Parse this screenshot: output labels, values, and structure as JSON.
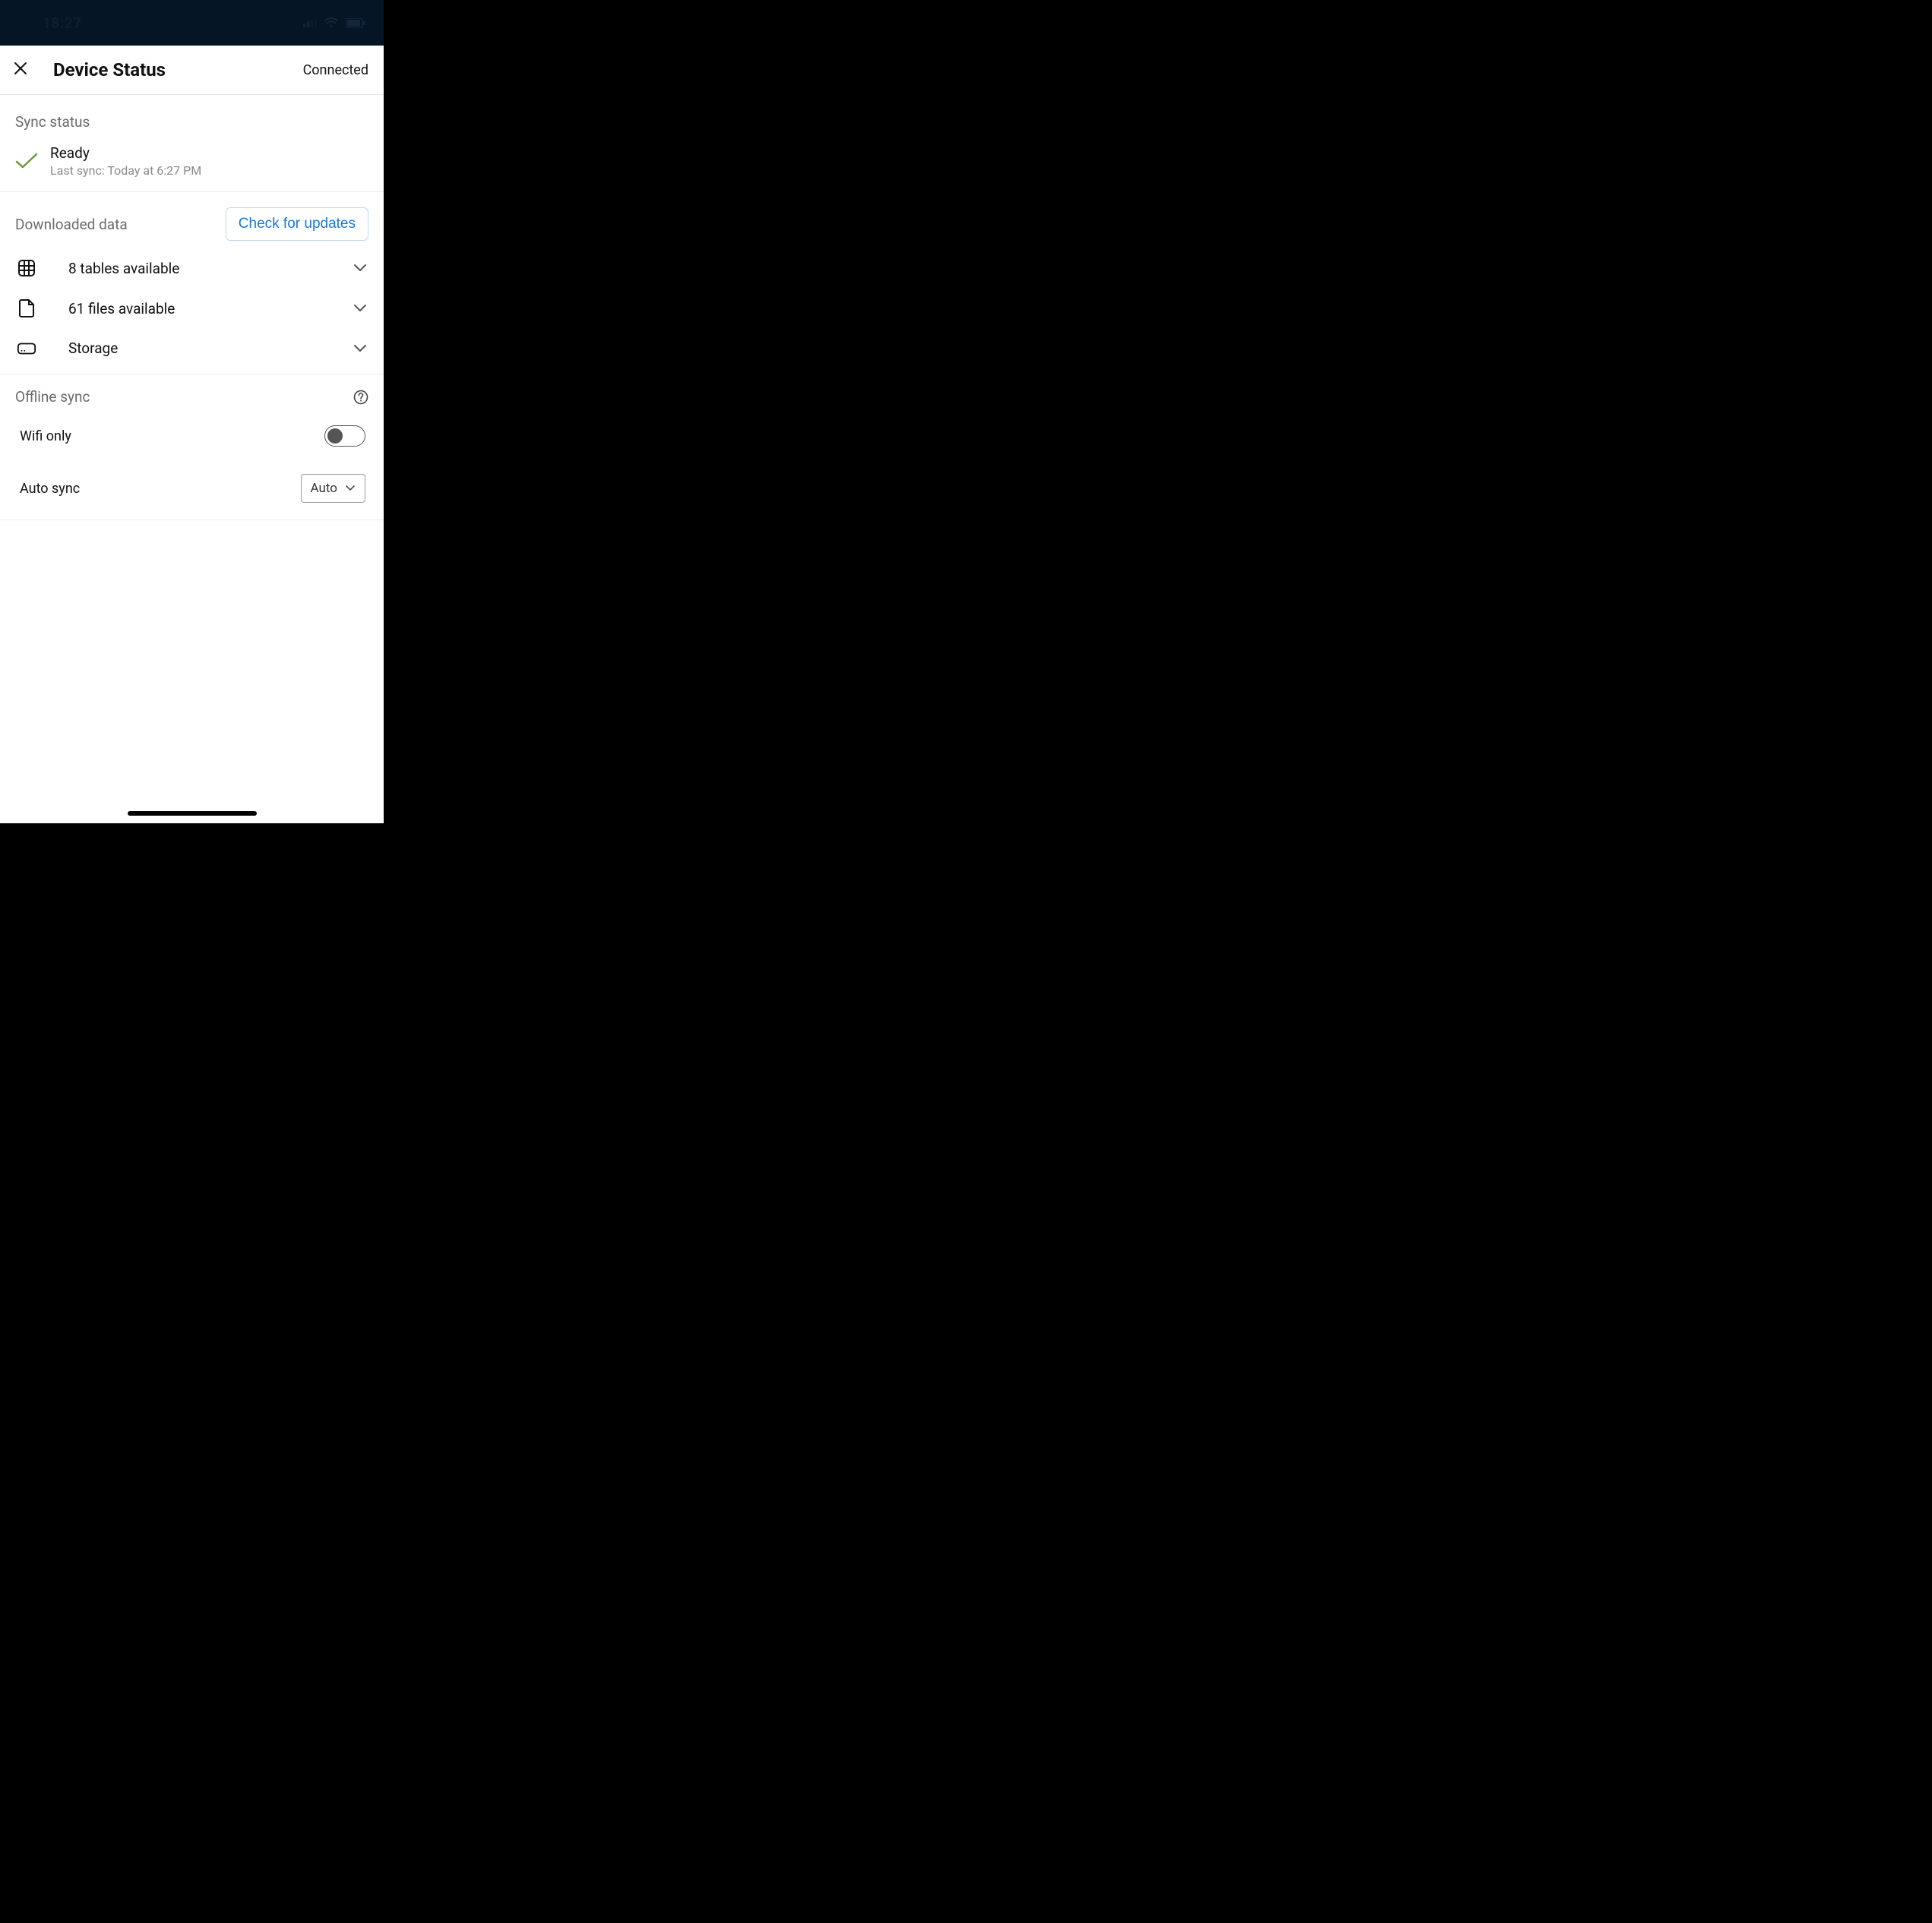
{
  "statusbar": {
    "time": "18:27"
  },
  "header": {
    "title": "Device Status",
    "connection": "Connected"
  },
  "sync": {
    "section_label": "Sync status",
    "ready_label": "Ready",
    "last_sync": "Last sync: Today at 6:27 PM"
  },
  "downloaded": {
    "section_label": "Downloaded data",
    "check_button": "Check for updates",
    "rows": [
      {
        "icon": "grid-icon",
        "label": "8 tables available"
      },
      {
        "icon": "file-icon",
        "label": "61 files available"
      },
      {
        "icon": "storage-icon",
        "label": "Storage"
      }
    ]
  },
  "offline": {
    "section_label": "Offline sync",
    "wifi_only_label": "Wifi only",
    "wifi_only_on": false,
    "auto_sync_label": "Auto sync",
    "auto_sync_value": "Auto"
  }
}
